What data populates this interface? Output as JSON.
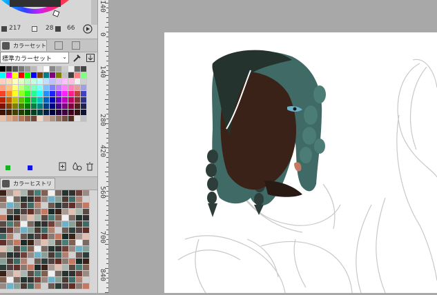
{
  "color_panel": {
    "h_value": "217",
    "s_value": "28",
    "v_value": "66"
  },
  "color_set": {
    "tab_label": "カラーセット",
    "preset_name": "標準カラーセット"
  },
  "color_history": {
    "tab_label": "カラーヒストリー"
  },
  "ruler": {
    "labels": [
      "140",
      "0",
      "140",
      "280",
      "420",
      "560",
      "700",
      "840"
    ]
  },
  "colors": {
    "canvas_bg": "#a8a8a8",
    "paper": "#ffffff",
    "hair": "#3e6a64",
    "skin": "#3a2218",
    "sketch": "#bdbdbd"
  }
}
